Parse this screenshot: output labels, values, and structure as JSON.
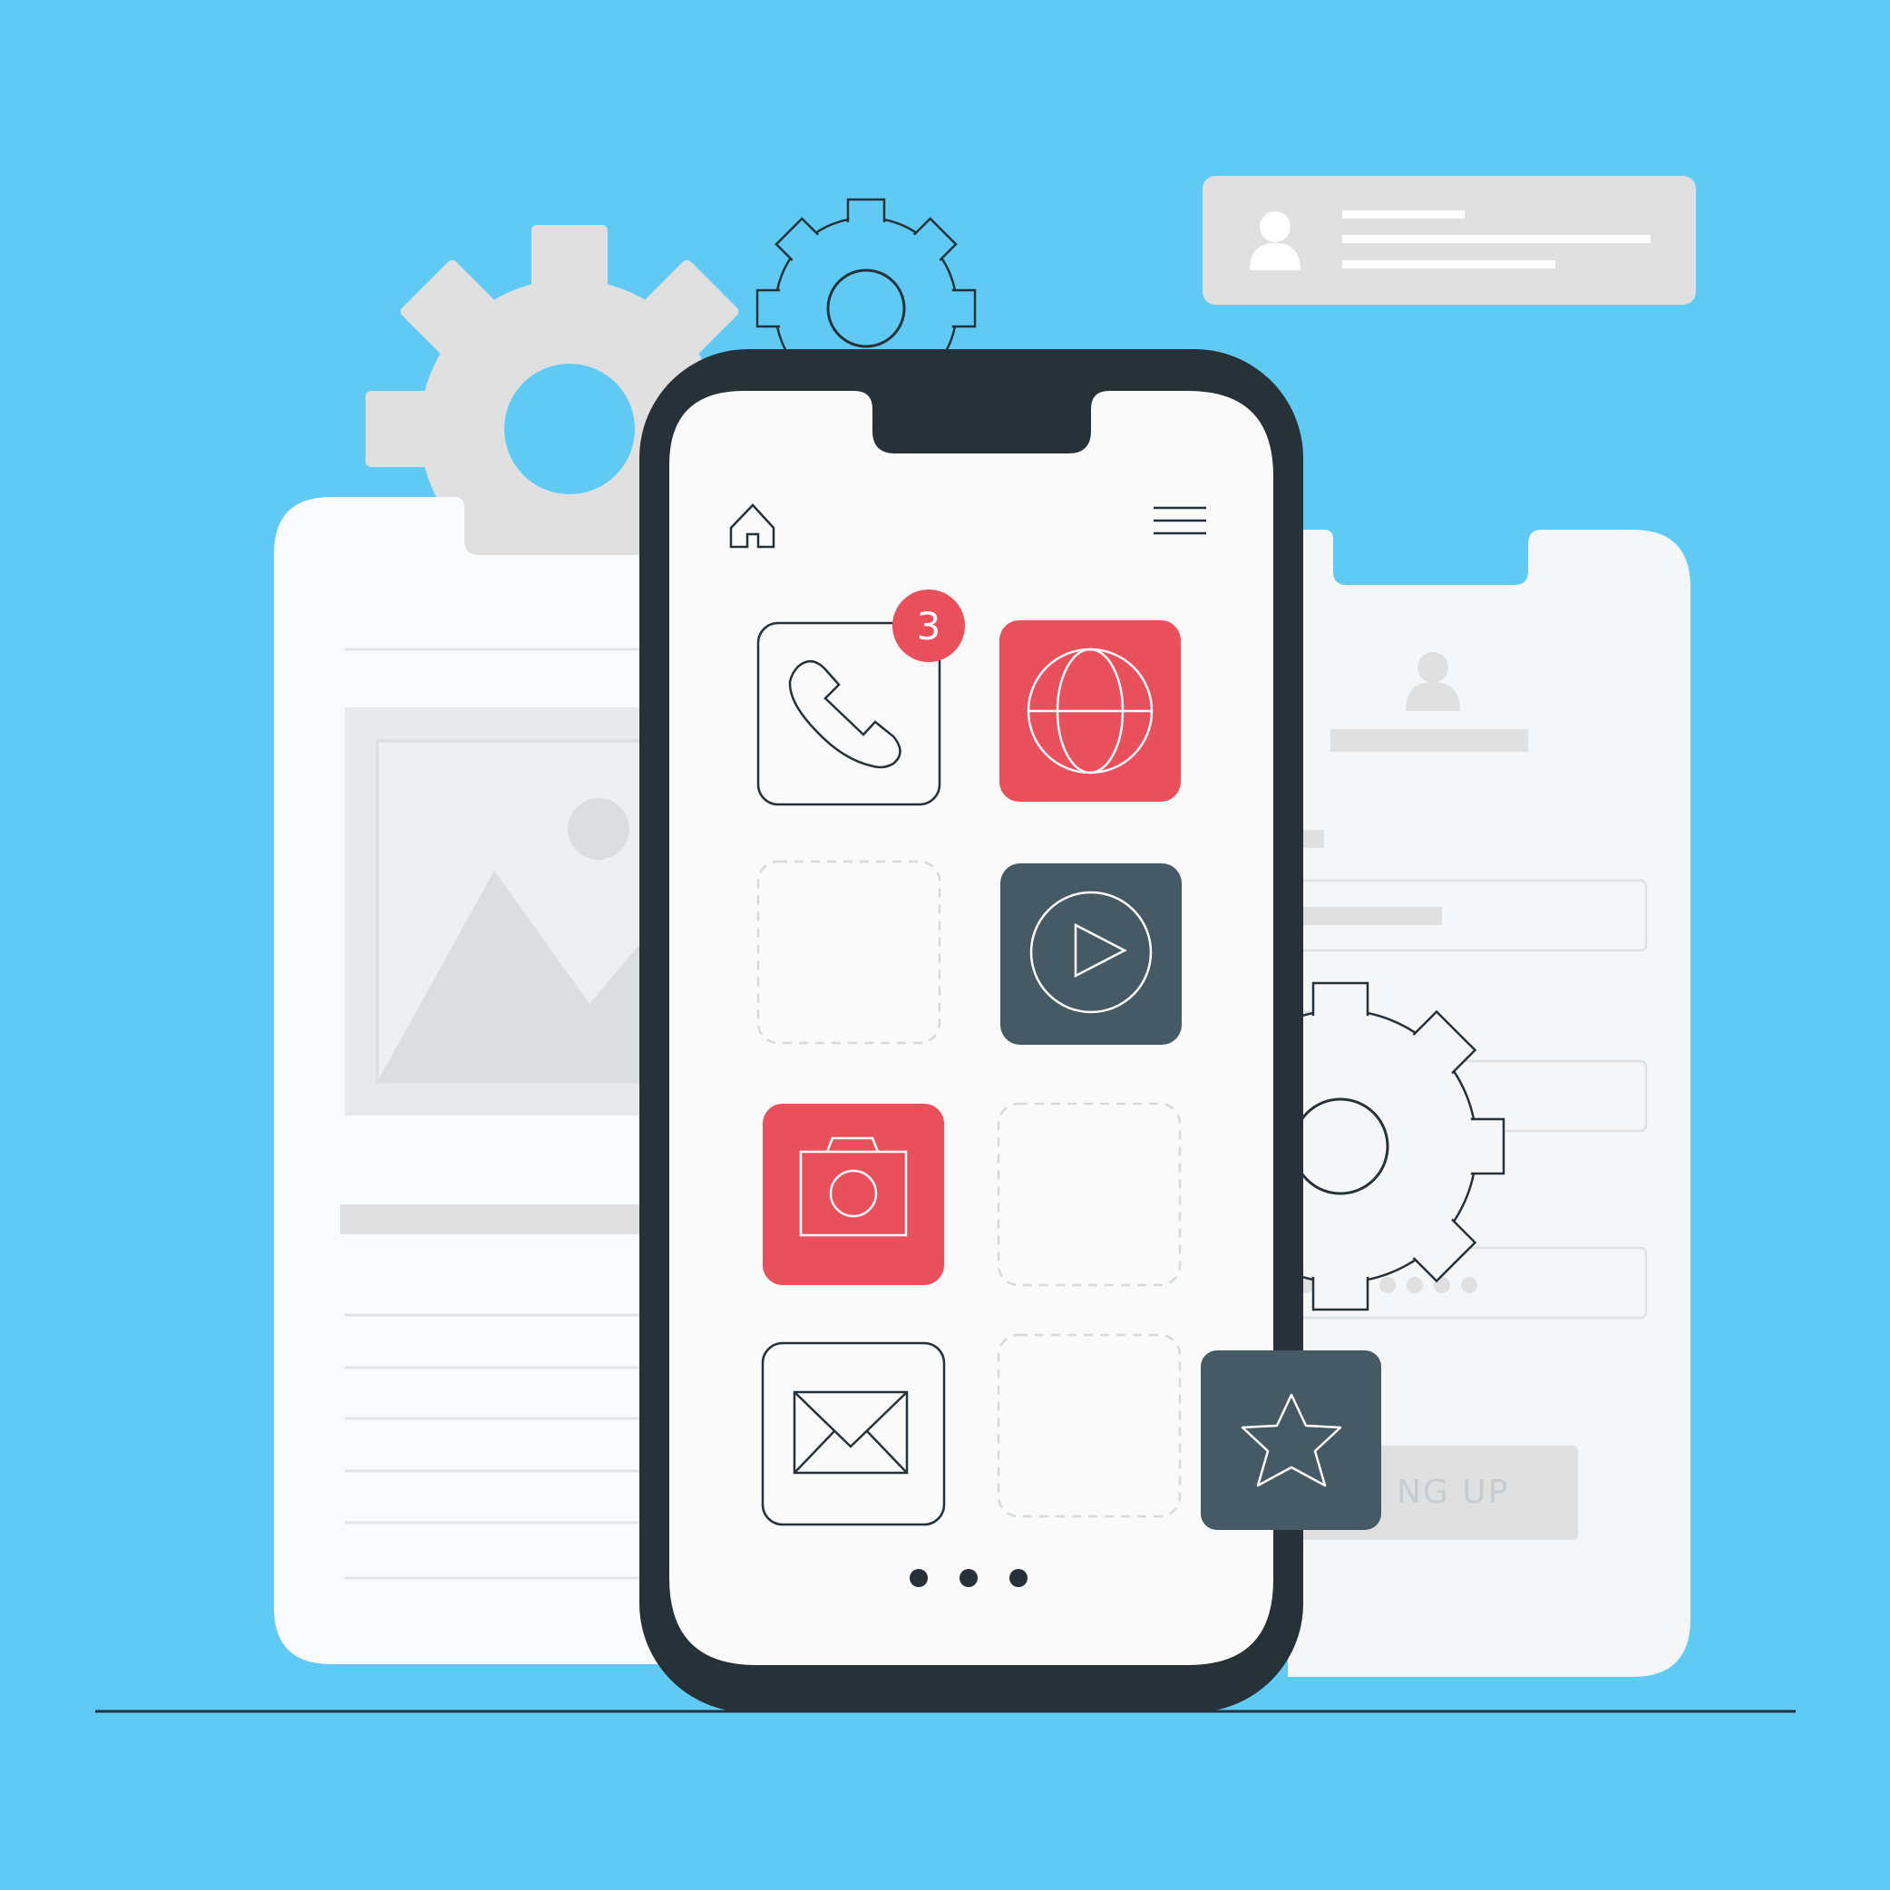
{
  "colors": {
    "background": "#5fcbf4",
    "phone_body": "#263238",
    "screen": "#fafafa",
    "accent_red": "#e9505c",
    "slate": "#455a64",
    "light_gray": "#e0e0e0",
    "card": "#f5f6f7"
  },
  "phone": {
    "nav": {
      "home_icon": "home-icon",
      "menu_icon": "hamburger-menu-icon"
    },
    "apps": [
      {
        "name": "phone-app",
        "icon": "phone-icon",
        "style": "outline",
        "badge": "3"
      },
      {
        "name": "browser-app",
        "icon": "globe-icon",
        "style": "red"
      },
      {
        "name": "empty-slot",
        "style": "dashed"
      },
      {
        "name": "video-app",
        "icon": "play-icon",
        "style": "slate"
      },
      {
        "name": "camera-app",
        "icon": "camera-icon",
        "style": "red"
      },
      {
        "name": "empty-slot",
        "style": "dashed"
      },
      {
        "name": "mail-app",
        "icon": "envelope-icon",
        "style": "outline"
      },
      {
        "name": "empty-slot",
        "style": "dashed"
      }
    ],
    "page_dots": 3,
    "floating_tile": {
      "icon": "star-icon",
      "style": "slate"
    }
  },
  "right_card": {
    "signup_label": "NG UP",
    "password_dots": 7
  },
  "profile_card": {
    "icon": "user-icon"
  }
}
